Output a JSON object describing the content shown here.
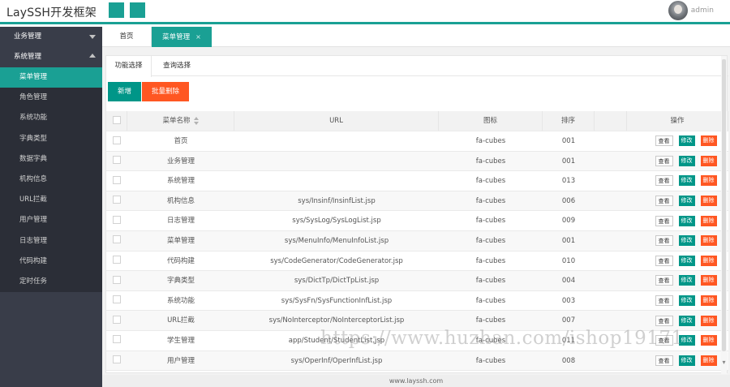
{
  "header": {
    "logo": "LaySSH开发框架",
    "username": "admin"
  },
  "sidebar": {
    "groups": [
      {
        "label": "业务管理",
        "expanded": false
      },
      {
        "label": "系统管理",
        "expanded": true
      }
    ],
    "items": [
      "菜单管理",
      "角色管理",
      "系统功能",
      "字典类型",
      "数据字典",
      "机构信息",
      "URL拦截",
      "用户管理",
      "日志管理",
      "代码构建",
      "定时任务"
    ],
    "active_item": "菜单管理"
  },
  "tabs": {
    "home": "首页",
    "current": "菜单管理",
    "close": "×"
  },
  "subtabs": [
    "功能选择",
    "查询选择"
  ],
  "toolbar": {
    "add": "新增",
    "batch_delete": "批量删除"
  },
  "table": {
    "headers": [
      "菜单名称",
      "URL",
      "图标",
      "排序",
      "",
      "操作"
    ],
    "actions": {
      "view": "查看",
      "edit": "修改",
      "delete": "删除"
    },
    "rows": [
      {
        "name": "首页",
        "url": "",
        "icon": "fa-cubes",
        "order": "001"
      },
      {
        "name": "业务管理",
        "url": "",
        "icon": "fa-cubes",
        "order": "001"
      },
      {
        "name": "系统管理",
        "url": "",
        "icon": "fa-cubes",
        "order": "013"
      },
      {
        "name": "机构信息",
        "url": "sys/Insinf/InsinfList.jsp",
        "icon": "fa-cubes",
        "order": "006"
      },
      {
        "name": "日志管理",
        "url": "sys/SysLog/SysLogList.jsp",
        "icon": "fa-cubes",
        "order": "009"
      },
      {
        "name": "菜单管理",
        "url": "sys/MenuInfo/MenuInfoList.jsp",
        "icon": "fa-cubes",
        "order": "001"
      },
      {
        "name": "代码构建",
        "url": "sys/CodeGenerator/CodeGenerator.jsp",
        "icon": "fa-cubes",
        "order": "010"
      },
      {
        "name": "字典类型",
        "url": "sys/DictTp/DictTpList.jsp",
        "icon": "fa-cubes",
        "order": "004"
      },
      {
        "name": "系统功能",
        "url": "sys/SysFn/SysFunctionInfList.jsp",
        "icon": "fa-cubes",
        "order": "003"
      },
      {
        "name": "URL拦截",
        "url": "sys/NoInterceptor/NoInterceptorList.jsp",
        "icon": "fa-cubes",
        "order": "007"
      },
      {
        "name": "学生管理",
        "url": "app/Student/StudentList.jsp",
        "icon": "fa-cubes",
        "order": "011"
      },
      {
        "name": "用户管理",
        "url": "sys/OperInf/OperInfList.jsp",
        "icon": "fa-cubes",
        "order": "008"
      }
    ]
  },
  "footer": "www.layssh.com",
  "watermark": "https://www.huzhan.com/ishop19171",
  "colors": {
    "accent": "#1aa094",
    "danger": "#ff5722",
    "sidebar": "#393d49"
  }
}
